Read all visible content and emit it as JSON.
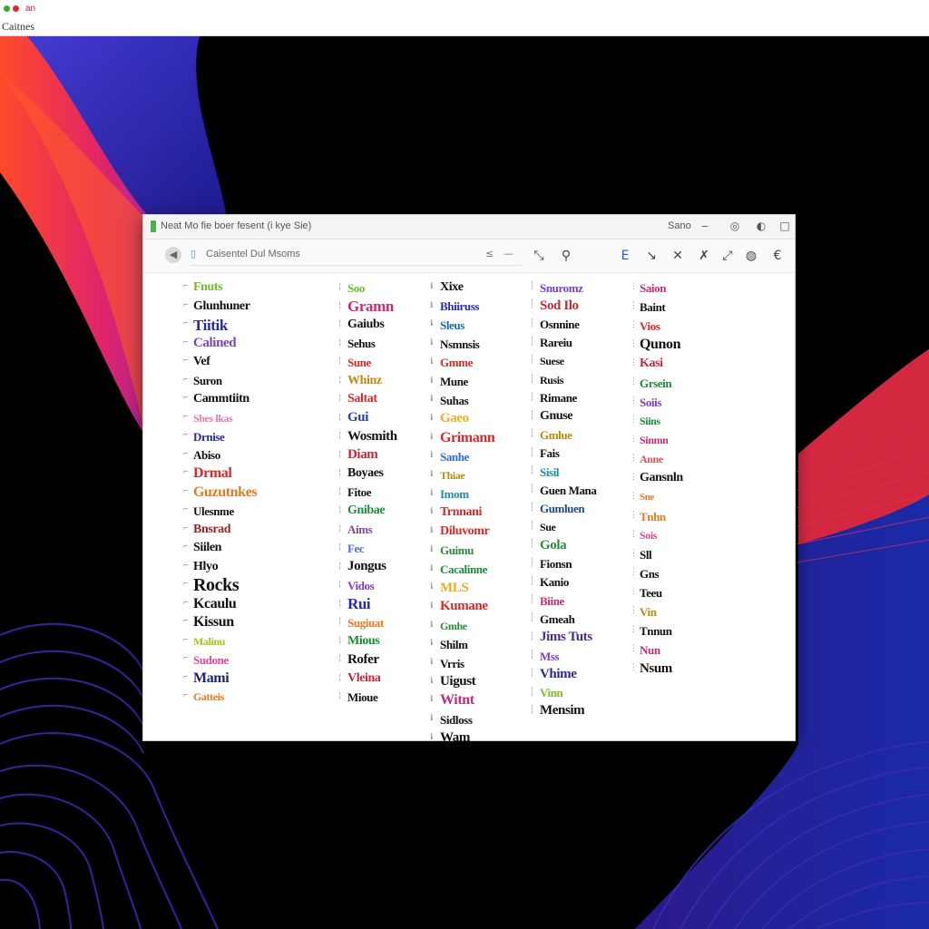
{
  "system_bar": {
    "indicator_text": "an",
    "app_name": "Caitnes",
    "colors": {
      "green": "#3aa935",
      "red": "#e0282e"
    }
  },
  "window": {
    "title": "Neat Mo fie boer fesent (i kye Sie)",
    "menu_label": "Sano",
    "address": "Caisentel Dul Msoms",
    "accent": "#4a6ad9"
  },
  "entries": [
    [
      {
        "text": "Fnuts",
        "color": "#6dbb2a",
        "size": 14
      },
      {
        "text": "Glunhuner",
        "color": "#111111",
        "size": 14
      },
      {
        "text": "Tiitik",
        "color": "#2a2aa8",
        "size": 17
      },
      {
        "text": "Calined",
        "color": "#7b3fbf",
        "size": 15
      },
      {
        "text": "Vef",
        "color": "#111111",
        "size": 14
      },
      {
        "text": "Suron",
        "color": "#111111",
        "size": 13
      },
      {
        "text": "Cammtiitn",
        "color": "#111111",
        "size": 14
      },
      {
        "text": "Shes lkas",
        "color": "#e97aa8",
        "size": 12
      },
      {
        "text": "Drnise",
        "color": "#2a2a8a",
        "size": 13
      },
      {
        "text": "Abiso",
        "color": "#111111",
        "size": 13
      },
      {
        "text": "Drmal",
        "color": "#d22a2a",
        "size": 16
      },
      {
        "text": "Guzutnkes",
        "color": "#e07a20",
        "size": 16
      },
      {
        "text": "Ulesnme",
        "color": "#111111",
        "size": 13
      },
      {
        "text": "Bnsrad",
        "color": "#9a2222",
        "size": 14
      },
      {
        "text": "Siilen",
        "color": "#111111",
        "size": 14
      },
      {
        "text": "Hlyo",
        "color": "#111111",
        "size": 14
      },
      {
        "text": "Rocks",
        "color": "#111111",
        "size": 20
      },
      {
        "text": "Kcaulu",
        "color": "#111111",
        "size": 16
      },
      {
        "text": "Kissun",
        "color": "#111111",
        "size": 16
      },
      {
        "text": "Malinu",
        "color": "#a3c41e",
        "size": 12
      },
      {
        "text": "Sudone",
        "color": "#d6489c",
        "size": 13
      },
      {
        "text": "Mami",
        "color": "#222266",
        "size": 16
      },
      {
        "text": "Gatteis",
        "color": "#e07a20",
        "size": 12
      }
    ],
    [
      {
        "text": "Soo",
        "color": "#6dbb2a",
        "size": 13
      },
      {
        "text": "Gramn",
        "color": "#c02c78",
        "size": 17
      },
      {
        "text": "Gaiubs",
        "color": "#111111",
        "size": 14
      },
      {
        "text": "Sehus",
        "color": "#111111",
        "size": 13
      },
      {
        "text": "Sune",
        "color": "#d22a2a",
        "size": 13
      },
      {
        "text": "Whinz",
        "color": "#b88a10",
        "size": 14
      },
      {
        "text": "Saltat",
        "color": "#d22a2a",
        "size": 14
      },
      {
        "text": "Gui",
        "color": "#2a3aa8",
        "size": 15
      },
      {
        "text": "Wosmith",
        "color": "#111111",
        "size": 15
      },
      {
        "text": "Diam",
        "color": "#c0283a",
        "size": 15
      },
      {
        "text": "Boyaes",
        "color": "#111111",
        "size": 14
      },
      {
        "text": "Fitoe",
        "color": "#111111",
        "size": 13
      },
      {
        "text": "Gnibae",
        "color": "#1a8a3a",
        "size": 14
      },
      {
        "text": "Aims",
        "color": "#7a4a9a",
        "size": 13
      },
      {
        "text": "Fec",
        "color": "#4a6ad9",
        "size": 13
      },
      {
        "text": "Jongus",
        "color": "#111111",
        "size": 15
      },
      {
        "text": "Vidos",
        "color": "#7b3fbf",
        "size": 13
      },
      {
        "text": "Rui",
        "color": "#2a2aa8",
        "size": 17
      },
      {
        "text": "Sugiuat",
        "color": "#e07a20",
        "size": 13
      },
      {
        "text": "Mious",
        "color": "#1a8a3a",
        "size": 14
      },
      {
        "text": "Rofer",
        "color": "#111111",
        "size": 15
      },
      {
        "text": "Vleina",
        "color": "#c0283a",
        "size": 14
      },
      {
        "text": "Mioue",
        "color": "#111111",
        "size": 13
      }
    ],
    [
      {
        "text": "Xixe",
        "color": "#111111",
        "size": 14
      },
      {
        "text": "Bhiiruss",
        "color": "#2a2aa8",
        "size": 13
      },
      {
        "text": "Sleus",
        "color": "#1a6aa8",
        "size": 13
      },
      {
        "text": "Nsmnsis",
        "color": "#111111",
        "size": 13
      },
      {
        "text": "Gmme",
        "color": "#d22a2a",
        "size": 13
      },
      {
        "text": "Mune",
        "color": "#111111",
        "size": 13
      },
      {
        "text": "Suhas",
        "color": "#111111",
        "size": 13
      },
      {
        "text": "Gaeo",
        "color": "#e8b020",
        "size": 15
      },
      {
        "text": "Grimann",
        "color": "#d22a2a",
        "size": 16
      },
      {
        "text": "Sanhe",
        "color": "#2a6ad9",
        "size": 13
      },
      {
        "text": "Thiae",
        "color": "#b88a10",
        "size": 12
      },
      {
        "text": "Imom",
        "color": "#1a8aa8",
        "size": 13
      },
      {
        "text": "Trnnani",
        "color": "#d22a2a",
        "size": 14
      },
      {
        "text": "Diluvomr",
        "color": "#d22a2a",
        "size": 14
      },
      {
        "text": "Guimu",
        "color": "#2a8a3a",
        "size": 13
      },
      {
        "text": "Cacalinne",
        "color": "#1a8a3a",
        "size": 13
      },
      {
        "text": "MLS",
        "color": "#e8b020",
        "size": 15
      },
      {
        "text": "Kumane",
        "color": "#d22a2a",
        "size": 15
      },
      {
        "text": "Gmhe",
        "color": "#2a8a3a",
        "size": 12
      },
      {
        "text": "Shilm",
        "color": "#111111",
        "size": 13
      },
      {
        "text": "Vrris",
        "color": "#111111",
        "size": 13
      },
      {
        "text": "Uigust",
        "color": "#111111",
        "size": 15
      },
      {
        "text": "Witnt",
        "color": "#c02c78",
        "size": 16
      },
      {
        "text": "Sidloss",
        "color": "#111111",
        "size": 13
      },
      {
        "text": "Wam",
        "color": "#111111",
        "size": 15
      }
    ],
    [
      {
        "text": "Snuromz",
        "color": "#7b3fbf",
        "size": 13
      },
      {
        "text": "Sod Ilo",
        "color": "#c0283a",
        "size": 15
      },
      {
        "text": "Osnnine",
        "color": "#111111",
        "size": 13
      },
      {
        "text": "Rareiu",
        "color": "#111111",
        "size": 13
      },
      {
        "text": "Suese",
        "color": "#111111",
        "size": 12
      },
      {
        "text": "Rusis",
        "color": "#111111",
        "size": 12
      },
      {
        "text": "Rimane",
        "color": "#111111",
        "size": 13
      },
      {
        "text": "Gnuse",
        "color": "#111111",
        "size": 14
      },
      {
        "text": "Gmlue",
        "color": "#b88a10",
        "size": 13
      },
      {
        "text": "Fais",
        "color": "#111111",
        "size": 13
      },
      {
        "text": "Sisil",
        "color": "#1a8aa8",
        "size": 13
      },
      {
        "text": "Guen Mana",
        "color": "#111111",
        "size": 13
      },
      {
        "text": "Gumluen",
        "color": "#1a4a8a",
        "size": 13
      },
      {
        "text": "Sue",
        "color": "#111111",
        "size": 12
      },
      {
        "text": "Gola",
        "color": "#2a8a3a",
        "size": 15
      },
      {
        "text": "Fionsn",
        "color": "#111111",
        "size": 13
      },
      {
        "text": "Kanio",
        "color": "#111111",
        "size": 13
      },
      {
        "text": "Biine",
        "color": "#c02c78",
        "size": 13
      },
      {
        "text": "Gmeah",
        "color": "#111111",
        "size": 13
      },
      {
        "text": "Jims Tuts",
        "color": "#4a2a8a",
        "size": 15
      },
      {
        "text": "Mss",
        "color": "#7b3fbf",
        "size": 13
      },
      {
        "text": "Vhime",
        "color": "#2a2a8a",
        "size": 15
      },
      {
        "text": "Vinn",
        "color": "#7bbb2a",
        "size": 13
      },
      {
        "text": "Mensim",
        "color": "#111111",
        "size": 15
      }
    ],
    [
      {
        "text": "Saion",
        "color": "#c02c78",
        "size": 13
      },
      {
        "text": "Baint",
        "color": "#111111",
        "size": 13
      },
      {
        "text": "Vios",
        "color": "#d22a2a",
        "size": 13
      },
      {
        "text": "Qunon",
        "color": "#111111",
        "size": 16
      },
      {
        "text": "Kasi",
        "color": "#c0283a",
        "size": 14
      },
      {
        "text": "Grsein",
        "color": "#1a8a3a",
        "size": 13
      },
      {
        "text": "Soiis",
        "color": "#7b3fbf",
        "size": 13
      },
      {
        "text": "Siins",
        "color": "#1a8a3a",
        "size": 12
      },
      {
        "text": "Sinmn",
        "color": "#c02c78",
        "size": 12
      },
      {
        "text": "Anne",
        "color": "#e05050",
        "size": 12
      },
      {
        "text": "Gansnln",
        "color": "#111111",
        "size": 14
      },
      {
        "text": "Sne",
        "color": "#e07a20",
        "size": 11
      },
      {
        "text": "Tnhn",
        "color": "#e07a20",
        "size": 13
      },
      {
        "text": "Sois",
        "color": "#d6489c",
        "size": 12
      },
      {
        "text": "Sll",
        "color": "#111111",
        "size": 13
      },
      {
        "text": "Gns",
        "color": "#111111",
        "size": 13
      },
      {
        "text": "Teeu",
        "color": "#111111",
        "size": 13
      },
      {
        "text": "Vin",
        "color": "#b88a10",
        "size": 13
      },
      {
        "text": "Tnnun",
        "color": "#111111",
        "size": 13
      },
      {
        "text": "Nun",
        "color": "#c02c78",
        "size": 13
      },
      {
        "text": "Nsum",
        "color": "#111111",
        "size": 15
      }
    ]
  ]
}
